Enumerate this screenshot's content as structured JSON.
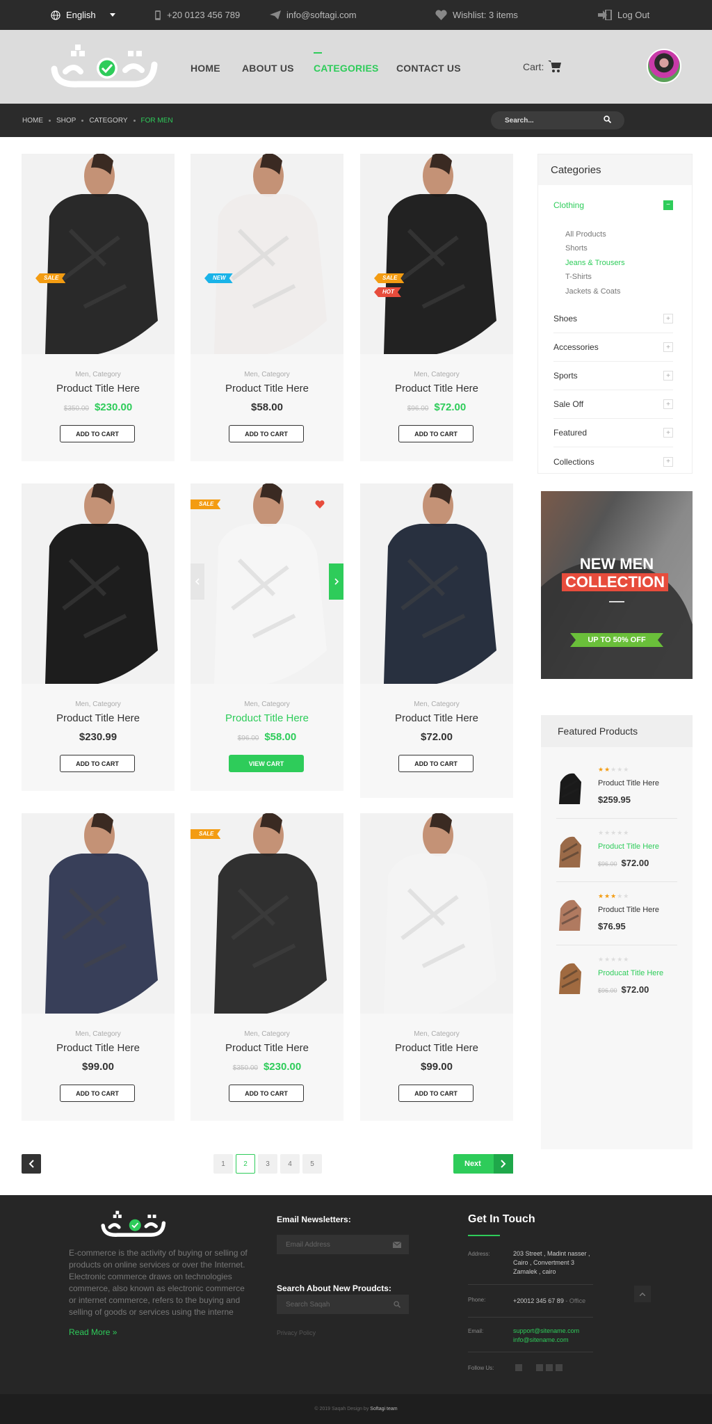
{
  "topbar": {
    "language": "English",
    "phone": "+20 0123 456 789",
    "email": "info@softagi.com",
    "wishlist": "Wishlist: 3 items",
    "logout": "Log Out"
  },
  "nav": {
    "home": "HOME",
    "about": "ABOUT US",
    "categories": "CATEGORIES",
    "contact": "CONTACT US",
    "cart": "Cart:"
  },
  "breadcrumb": [
    "HOME",
    "SHOP",
    "CATEGORY",
    "FOR MEN"
  ],
  "search": {
    "placeholder": "Search..."
  },
  "products": [
    {
      "cat": "Men, Category",
      "title": "Product Title Here",
      "old": "$350.00",
      "price": "$230.00",
      "btn": "ADD TO CART",
      "tags": [
        "SALE"
      ]
    },
    {
      "cat": "Men, Category",
      "title": "Product Title Here",
      "old": "",
      "price": "$58.00",
      "btn": "ADD TO CART",
      "tags": [
        "NEW"
      ]
    },
    {
      "cat": "Men, Category",
      "title": "Product Title Here",
      "old": "$96.00",
      "price": "$72.00",
      "btn": "ADD TO CART",
      "tags": [
        "SALE",
        "HOT"
      ]
    },
    {
      "cat": "Men, Category",
      "title": "Product Title Here",
      "old": "",
      "price": "$230.99",
      "btn": "ADD TO CART",
      "tags": []
    },
    {
      "cat": "Men, Category",
      "title": "Product Title Here",
      "old": "$96.00",
      "price": "$58.00",
      "btn": "VIEW CART",
      "tags": [
        "SALE"
      ]
    },
    {
      "cat": "Men, Category",
      "title": "Product Title Here",
      "old": "",
      "price": "$72.00",
      "btn": "ADD TO CART",
      "tags": []
    },
    {
      "cat": "Men, Category",
      "title": "Product Title Here",
      "old": "",
      "price": "$99.00",
      "btn": "ADD TO CART",
      "tags": []
    },
    {
      "cat": "Men, Category",
      "title": "Product Title Here",
      "old": "$350.00",
      "price": "$230.00",
      "btn": "ADD TO CART",
      "tags": [
        "SALE"
      ]
    },
    {
      "cat": "Men, Category",
      "title": "Product Title Here",
      "old": "",
      "price": "$99.00",
      "btn": "ADD TO CART",
      "tags": []
    }
  ],
  "sidebar": {
    "title": "Categories",
    "categories": [
      "Clothing",
      "Shoes",
      "Accessories",
      "Sports",
      "Sale Off",
      "Featured",
      "Collections"
    ],
    "subcategories": [
      "All Products",
      "Shorts",
      "Jeans & Trousers",
      "T-Shirts",
      "Jackets & Coats"
    ],
    "active_sub": "Jeans & Trousers"
  },
  "banner": {
    "line1": "NEW MEN",
    "line2": "COLLECTION",
    "offer": "UP TO 50% OFF"
  },
  "featured": {
    "title": "Featured Products",
    "items": [
      {
        "name": "Product Title Here",
        "old": "",
        "price": "$259.95",
        "rating": 2
      },
      {
        "name": "Product Title Here",
        "old": "$96.00",
        "price": "$72.00",
        "rating": 0
      },
      {
        "name": "Product Title Here",
        "old": "",
        "price": "$76.95",
        "rating": 3
      },
      {
        "name": "Producat Title Here",
        "old": "$96.00",
        "price": "$72.00",
        "rating": 0
      }
    ]
  },
  "pagination": {
    "pages": [
      "1",
      "2",
      "3",
      "4",
      "5"
    ],
    "current": "2",
    "next": "Next"
  },
  "footer": {
    "about": "E-commerce is the activity of buying or selling of products on online services or over the Internet. Electronic commerce draws on technologies commerce, also known as electronic commerce or internet commerce, refers to the buying and selling of goods or services using the interne",
    "read_more": "Read More »",
    "newsletter_title": "Email Newsletters:",
    "newsletter_placeholder": "Email Address",
    "search_title": "Search About New Proudcts:",
    "search_placeholder": "Search Saqah",
    "privacy": "Privacy Policy",
    "touch_title": "Get In Touch",
    "address_label": "Address:",
    "address": "203 Street , Madint nasser , Cairo , Convertment 3 Zamalek , cairo",
    "phone_label": "Phone:",
    "phone": "+20012 345 67 89",
    "phone_note": " - Office",
    "email_label": "Email:",
    "email1": "support@sitename.com",
    "email2": "info@sitename.com",
    "follow_label": "Follow Us:",
    "copyright": "© 2019 Saqah Design by ",
    "copyright_team": "Softagi team"
  }
}
